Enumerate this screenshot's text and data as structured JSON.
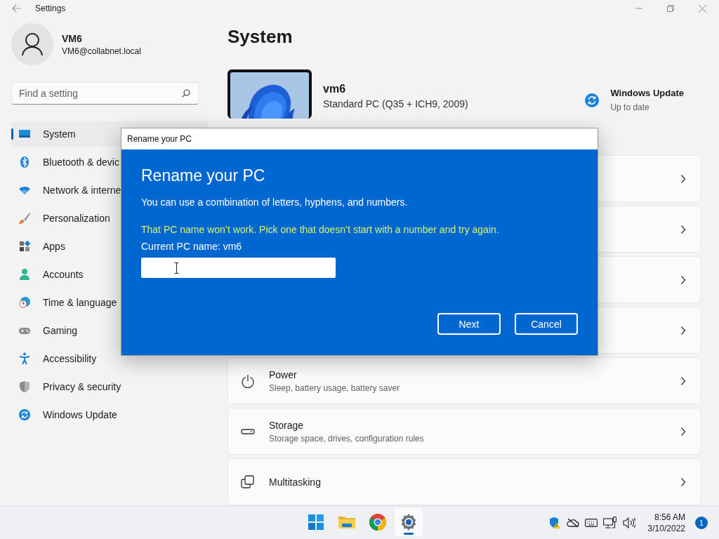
{
  "window": {
    "title": "Settings"
  },
  "profile": {
    "name": "VM6",
    "email": "VM6@collabnet.local"
  },
  "search": {
    "placeholder": "Find a setting"
  },
  "sidebar": {
    "items": [
      {
        "label": "System",
        "selected": true
      },
      {
        "label": "Bluetooth & devic",
        "selected": false
      },
      {
        "label": "Network & interne",
        "selected": false
      },
      {
        "label": "Personalization",
        "selected": false
      },
      {
        "label": "Apps",
        "selected": false
      },
      {
        "label": "Accounts",
        "selected": false
      },
      {
        "label": "Time & language",
        "selected": false
      },
      {
        "label": "Gaming",
        "selected": false
      },
      {
        "label": "Accessibility",
        "selected": false
      },
      {
        "label": "Privacy & security",
        "selected": false
      },
      {
        "label": "Windows Update",
        "selected": false
      }
    ]
  },
  "main": {
    "title": "System",
    "device": {
      "name": "vm6",
      "model": "Standard PC (Q35 + ICH9, 2009)"
    },
    "update": {
      "title": "Windows Update",
      "status": "Up to date"
    },
    "cards": [
      {
        "kind": "covered"
      },
      {
        "kind": "covered"
      },
      {
        "kind": "covered"
      },
      {
        "kind": "covered"
      },
      {
        "kind": "power",
        "title": "Power",
        "subtitle": "Sleep, battery usage, battery saver"
      },
      {
        "kind": "storage",
        "title": "Storage",
        "subtitle": "Storage space, drives, configuration rules"
      },
      {
        "kind": "multitasking",
        "title": "Multitasking"
      }
    ]
  },
  "dialog": {
    "title": "Rename your PC",
    "heading": "Rename your PC",
    "description": "You can use a combination of letters, hyphens, and numbers.",
    "error": "That PC name won’t work. Pick one that doesn’t start with a number and try again.",
    "current_name": "Current PC name: vm6",
    "buttons": [
      "Next",
      "Cancel"
    ]
  },
  "taskbar": {
    "apps": [
      {
        "kind": "start",
        "selected": false
      },
      {
        "kind": "folder",
        "selected": false
      },
      {
        "kind": "browser",
        "selected": false
      },
      {
        "kind": "settings",
        "selected": true
      }
    ],
    "time": "8:56 AM",
    "date": "3/10/2022",
    "notifications": "1"
  }
}
